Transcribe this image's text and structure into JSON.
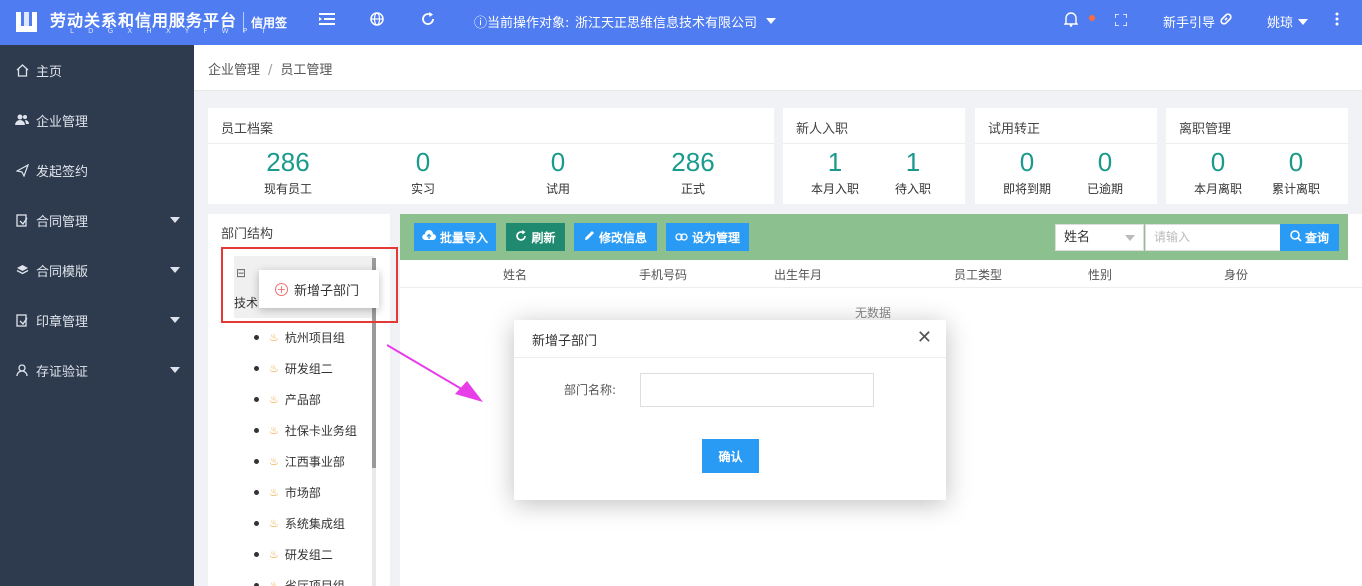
{
  "header": {
    "brand": "劳动关系和信用服务平台",
    "brand_sub": "L D G X H X Y F W P T",
    "brand_tag": "信用签",
    "operating_label": "ⓘ当前操作对象:",
    "operating_target": "浙江天正思维信息技术有限公司",
    "guide": "新手引导",
    "user": "姚琼"
  },
  "sidebar": {
    "items": [
      {
        "label": "主页",
        "icon": "home-icon"
      },
      {
        "label": "企业管理",
        "icon": "users-icon"
      },
      {
        "label": "发起签约",
        "icon": "send-icon"
      },
      {
        "label": "合同管理",
        "icon": "contract-icon"
      },
      {
        "label": "合同模版",
        "icon": "layers-icon"
      },
      {
        "label": "印章管理",
        "icon": "stamp-icon"
      },
      {
        "label": "存证验证",
        "icon": "user-icon"
      }
    ]
  },
  "breadcrumb": {
    "first": "企业管理",
    "second": "员工管理"
  },
  "cards": {
    "archive": {
      "title": "员工档案",
      "stats": [
        {
          "num": "286",
          "label": "现有员工"
        },
        {
          "num": "0",
          "label": "实习"
        },
        {
          "num": "0",
          "label": "试用"
        },
        {
          "num": "286",
          "label": "正式"
        }
      ]
    },
    "onboard": {
      "title": "新人入职",
      "stats": [
        {
          "num": "1",
          "label": "本月入职"
        },
        {
          "num": "1",
          "label": "待入职"
        }
      ]
    },
    "probation": {
      "title": "试用转正",
      "stats": [
        {
          "num": "0",
          "label": "即将到期"
        },
        {
          "num": "0",
          "label": "已逾期"
        }
      ]
    },
    "resign": {
      "title": "离职管理",
      "stats": [
        {
          "num": "0",
          "label": "本月离职"
        },
        {
          "num": "0",
          "label": "累计离职"
        }
      ]
    }
  },
  "dept": {
    "title": "部门结构",
    "root_label": "技术",
    "context_menu": "新增子部门",
    "items": [
      "杭州项目组",
      "研发组二",
      "产品部",
      "社保卡业务组",
      "江西事业部",
      "市场部",
      "系统集成组",
      "研发组二",
      "省厅项目组"
    ]
  },
  "toolbar": {
    "import": "批量导入",
    "refresh": "刷新",
    "edit": "修改信息",
    "set_admin": "设为管理",
    "select_value": "姓名",
    "search_placeholder": "请输入",
    "search_btn": "查询"
  },
  "table": {
    "columns": [
      "姓名",
      "手机号码",
      "出生年月",
      "员工类型",
      "性别",
      "身份"
    ],
    "empty": "无数据"
  },
  "modal": {
    "title": "新增子部门",
    "label": "部门名称:",
    "confirm": "确认"
  }
}
